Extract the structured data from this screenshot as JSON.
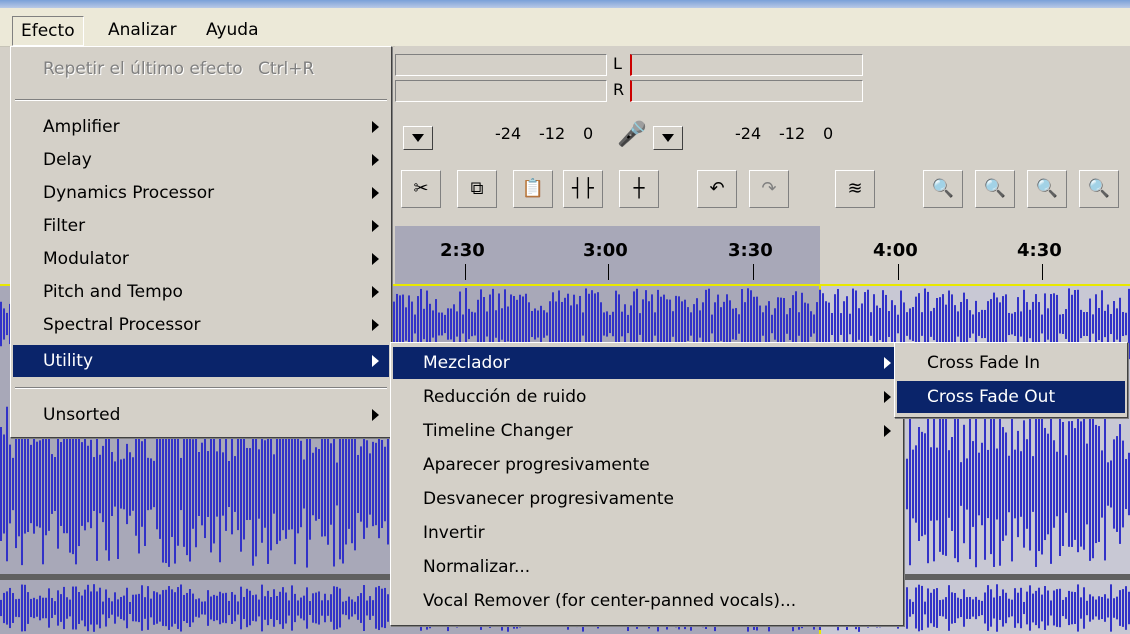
{
  "menubar": {
    "items": [
      "Efecto",
      "Analizar",
      "Ayuda"
    ]
  },
  "meters": {
    "left_label": "L",
    "right_label": "R",
    "scale_out": [
      "-24",
      "-12",
      "0"
    ],
    "scale_in": [
      "-24",
      "-12",
      "0"
    ]
  },
  "ruler": {
    "labels": [
      "2:30",
      "3:00",
      "3:30",
      "4:00",
      "4:30"
    ]
  },
  "effect_menu": {
    "repeat": {
      "label": "Repetir el último efecto",
      "shortcut": "Ctrl+R"
    },
    "items": [
      "Amplifier",
      "Delay",
      "Dynamics Processor",
      "Filter",
      "Modulator",
      "Pitch and Tempo",
      "Spectral Processor",
      "Utility"
    ],
    "unsorted": "Unsorted"
  },
  "utility_menu": {
    "items": [
      "Mezclador",
      "Reducción de ruido",
      "Timeline Changer",
      "Aparecer progresivamente",
      "Desvanecer progresivamente",
      "Invertir",
      "Normalizar...",
      "Vocal Remover (for center-panned vocals)..."
    ]
  },
  "mezclador_menu": {
    "items": [
      "Cross Fade In",
      "Cross Fade Out"
    ]
  },
  "colors": {
    "highlight": "#0a246a",
    "menu_bg": "#d4d0c8",
    "waveform": "#3232c8",
    "selection": "#a8a8b8"
  }
}
